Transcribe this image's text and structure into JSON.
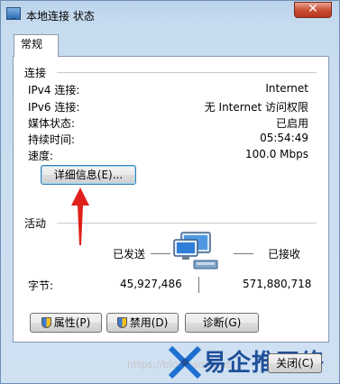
{
  "window": {
    "title": "本地连接 状态",
    "close_glyph": "✕"
  },
  "tabs": [
    {
      "label": "常规"
    }
  ],
  "connection": {
    "group_label": "连接",
    "rows": [
      {
        "label": "IPv4 连接:",
        "value": "Internet"
      },
      {
        "label": "IPv6 连接:",
        "value": "无 Internet 访问权限"
      },
      {
        "label": "媒体状态:",
        "value": "已启用"
      },
      {
        "label": "持续时间:",
        "value": "05:54:49"
      },
      {
        "label": "速度:",
        "value": "100.0 Mbps"
      }
    ],
    "details_button": "详细信息(E)..."
  },
  "activity": {
    "group_label": "活动",
    "sent_label": "已发送",
    "received_label": "已接收",
    "bytes_label": "字节:",
    "bytes_sent": "45,927,486",
    "bytes_received": "571,880,718"
  },
  "buttons": {
    "properties": "属性(P)",
    "disable": "禁用(D)",
    "diagnose": "诊断(G)",
    "close": "关闭(C)"
  },
  "watermark": {
    "logo_text": "易企推网络",
    "small_text": "https://blog.csdn.net/"
  },
  "colors": {
    "arrow": "#e0201a",
    "logo": "#1f4f9b"
  },
  "icons": [
    "network-icon",
    "shield-icon",
    "close-icon",
    "red-arrow-icon"
  ]
}
